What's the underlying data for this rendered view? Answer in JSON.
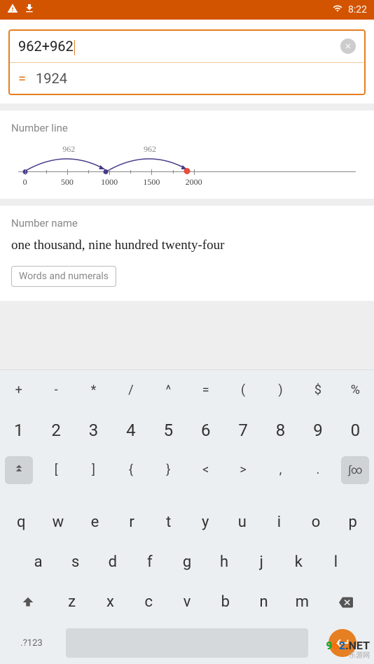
{
  "status": {
    "time": "8:22"
  },
  "input": {
    "expression": "962+962",
    "result": "1924",
    "equals": "="
  },
  "numberLine": {
    "title": "Number line",
    "ticks": [
      "0",
      "500",
      "1000",
      "1500",
      "2000"
    ],
    "arcLabel1": "962",
    "arcLabel2": "962"
  },
  "numberName": {
    "title": "Number name",
    "text": "one thousand, nine hundred twenty-four",
    "button": "Words and numerals"
  },
  "keyboard": {
    "row1": [
      "+",
      "-",
      "*",
      "/",
      "^",
      "=",
      "(",
      ")",
      "$",
      "%"
    ],
    "row2": [
      "1",
      "2",
      "3",
      "4",
      "5",
      "6",
      "7",
      "8",
      "9",
      "0"
    ],
    "row3": [
      "",
      "[",
      "]",
      "{",
      "}",
      "<",
      ">",
      ",",
      ".",
      ""
    ],
    "row4": [
      "q",
      "w",
      "e",
      "r",
      "t",
      "y",
      "u",
      "i",
      "o",
      "p"
    ],
    "row5": [
      "a",
      "s",
      "d",
      "f",
      "g",
      "h",
      "j",
      "k",
      "l"
    ],
    "row6": [
      "",
      "z",
      "x",
      "c",
      "v",
      "b",
      "n",
      "m",
      ""
    ],
    "row7": {
      "modeKey": ".?123"
    }
  },
  "watermark": {
    "digits": "962",
    "suffix": ".NET",
    "sub": "乐游网"
  }
}
